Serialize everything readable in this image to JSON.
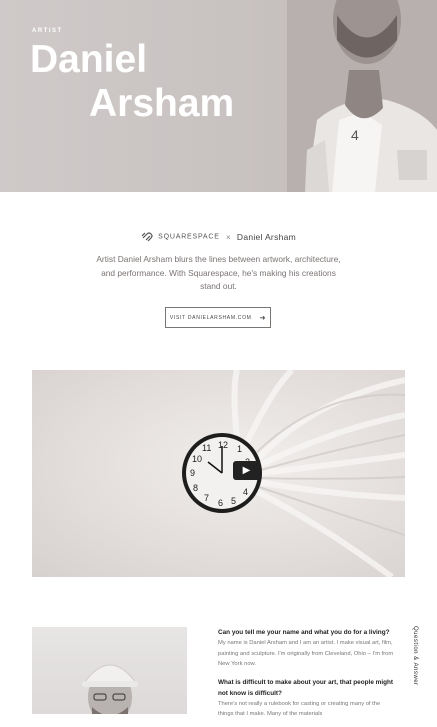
{
  "hero": {
    "eyebrow": "ARTIST",
    "title_line1": "Daniel",
    "title_line2": "Arsham"
  },
  "brand": {
    "logo_icon": "squarespace-logo-icon",
    "platform": "SQUARESPACE",
    "separator": "×",
    "artist": "Daniel Arsham"
  },
  "intro": {
    "text": "Artist Daniel Arsham blurs the lines between artwork, architecture, and performance. With Squarespace, he's making his creations stand out."
  },
  "cta": {
    "label": "VISIT DANIELARSHAM.COM",
    "arrow": "➜"
  },
  "video": {
    "play_icon": "▶",
    "clock_numbers": [
      "12",
      "1",
      "2",
      "3",
      "4",
      "5",
      "6",
      "7",
      "8",
      "9",
      "10",
      "11"
    ]
  },
  "qa": {
    "side_label": "Question & Answer",
    "items": [
      {
        "question": "Can you tell me your name and what you do for a living?",
        "answer": "My name is Daniel Arsham and I am an artist. I make visual art, film, painting and sculpture. I'm originally from Cleveland, Ohio – I'm from New York now."
      },
      {
        "question": "What is difficult to make about your art, that people might not know is difficult?",
        "answer": "There's not really a rulebook for casting or creating many of the things that I make. Many of the materials"
      }
    ]
  },
  "colors": {
    "hero_bg": "#c8c2c1",
    "text_dark": "#222222",
    "text_muted": "#7a7472"
  }
}
